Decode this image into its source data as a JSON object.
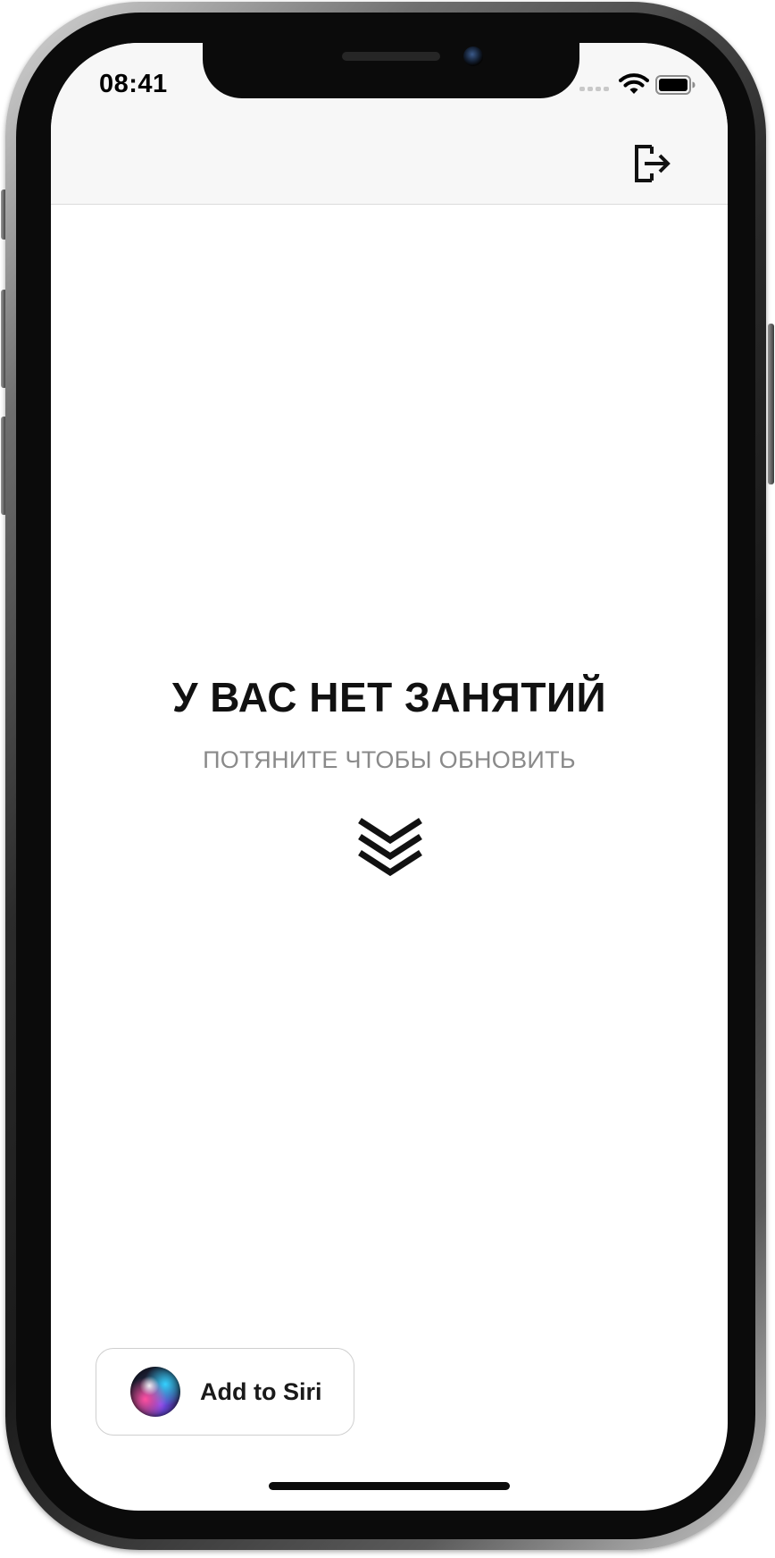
{
  "status_bar": {
    "time": "08:41",
    "signal_icon": "cellular-dots-icon",
    "wifi_icon": "wifi-icon",
    "battery_icon": "battery-icon"
  },
  "nav_bar": {
    "logout_icon": "logout-icon"
  },
  "empty_state": {
    "title": "У ВАС НЕТ ЗАНЯТИЙ",
    "subtitle": "ПОТЯНИТЕ ЧТОБЫ ОБНОВИТЬ",
    "icon": "double-chevron-down-icon"
  },
  "siri": {
    "label": "Add to Siri",
    "icon": "siri-icon"
  },
  "colors": {
    "nav_background": "#f7f7f7",
    "title": "#111111",
    "subtitle": "#8a8a8a",
    "background": "#ffffff"
  }
}
